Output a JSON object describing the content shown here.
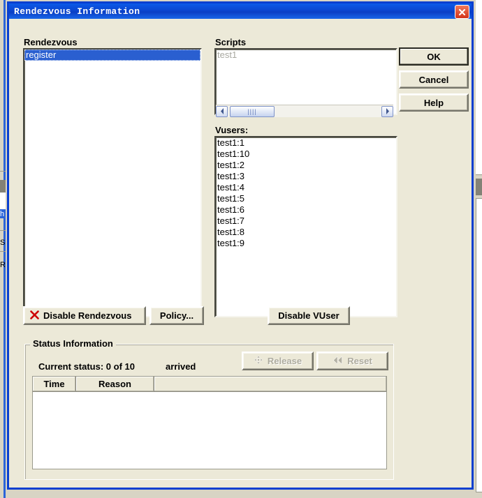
{
  "window": {
    "title": "Rendezvous Information",
    "close_icon": "close-x-icon"
  },
  "sections": {
    "rendezvous_label": "Rendezvous",
    "scripts_label": "Scripts",
    "vusers_label": "Vusers:",
    "status_group_label": "Status Information"
  },
  "rendezvous_list": [
    {
      "name": "register",
      "selected": true
    }
  ],
  "scripts_list": [
    {
      "name": "test1",
      "disabled": true
    }
  ],
  "scripts_scrollbar": {
    "left_arrow": "◀",
    "right_arrow": "▶",
    "thumb_grip": "||||"
  },
  "vusers_list": [
    "test1:1",
    "test1:10",
    "test1:2",
    "test1:3",
    "test1:4",
    "test1:5",
    "test1:6",
    "test1:7",
    "test1:8",
    "test1:9"
  ],
  "buttons": {
    "ok": "OK",
    "cancel": "Cancel",
    "help": "Help",
    "disable_rendezvous": "Disable Rendezvous",
    "policy": "Policy...",
    "disable_vuser": "Disable VUser",
    "release": "Release",
    "reset": "Reset"
  },
  "icons": {
    "disable_rendezvous": "red-x-icon",
    "release": "four-way-arrow-icon",
    "reset": "rewind-double-arrow-icon"
  },
  "status": {
    "prefix": "Current status: 0 of 10",
    "suffix": "arrived",
    "arrived_count": 0,
    "total_count": 10
  },
  "status_table": {
    "columns": [
      "Time",
      "Reason",
      ""
    ],
    "rows": []
  },
  "colors": {
    "title_bar": "#0b46d0",
    "dialog_frame": "#0a3fd0",
    "face": "#ece9d8",
    "selection": "#2a5fd0",
    "close_button": "#d3331a",
    "disabled_text": "#aeaca0",
    "red_x": "#cc0000"
  }
}
